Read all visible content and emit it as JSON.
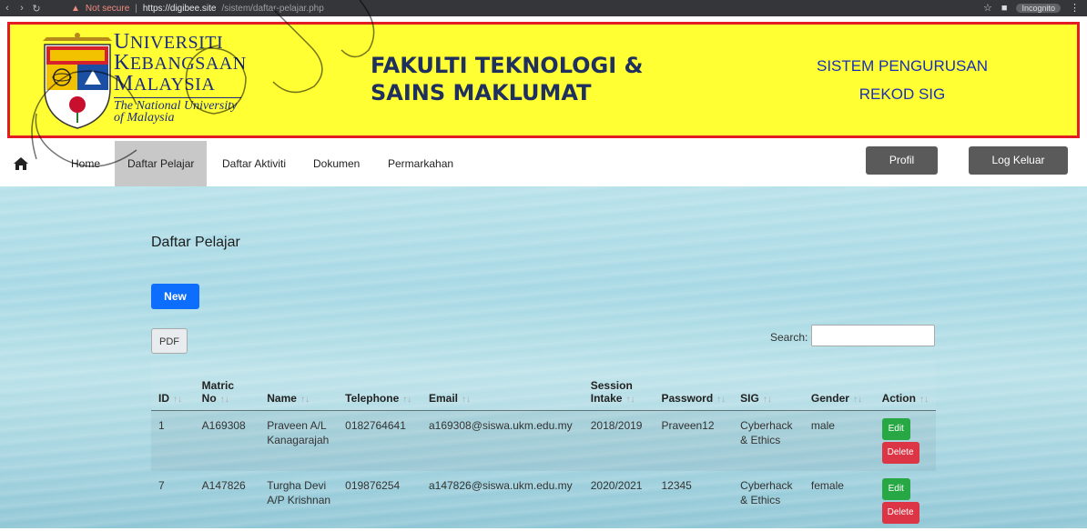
{
  "browser": {
    "security": "Not secure",
    "host": "https://digibee.site",
    "path": "/sistem/daftar-pelajar.php",
    "mode": "Incognito"
  },
  "header": {
    "ukm": {
      "line1_cap": "U",
      "line1_rest": "NIVERSITI",
      "line2_cap": "K",
      "line2_rest": "EBANGSAAN",
      "line3_cap": "M",
      "line3_rest": "ALAYSIA",
      "eng1": "The National University",
      "eng2": "of Malaysia"
    },
    "faculty_line1": "FAKULTI TEKNOLOGI &",
    "faculty_line2": "SAINS MAKLUMAT",
    "system_line1": "SISTEM PENGURUSAN",
    "system_line2": "REKOD SIG",
    "colors": {
      "banner": "#ffff33",
      "border": "#e31b23"
    }
  },
  "nav": {
    "items": [
      {
        "label": "Home"
      },
      {
        "label": "Daftar Pelajar"
      },
      {
        "label": "Daftar Aktiviti"
      },
      {
        "label": "Dokumen"
      },
      {
        "label": "Permarkahan"
      }
    ],
    "active": "Daftar Pelajar",
    "profile_label": "Profil",
    "logout_label": "Log Keluar"
  },
  "page": {
    "title": "Daftar Pelajar",
    "new_label": "New",
    "pdf_label": "PDF",
    "search_label": "Search:",
    "search_value": ""
  },
  "table": {
    "headers": [
      {
        "line1": "ID",
        "line2": ""
      },
      {
        "line1": "Matric",
        "line2": "No"
      },
      {
        "line1": "Name",
        "line2": ""
      },
      {
        "line1": "Telephone",
        "line2": ""
      },
      {
        "line1": "Email",
        "line2": ""
      },
      {
        "line1": "Session",
        "line2": "Intake"
      },
      {
        "line1": "Password",
        "line2": ""
      },
      {
        "line1": "SIG",
        "line2": ""
      },
      {
        "line1": "Gender",
        "line2": ""
      },
      {
        "line1": "Action",
        "line2": ""
      }
    ],
    "rows": [
      {
        "id": "1",
        "matric": "A169308",
        "name": "Praveen A/L Kanagarajah",
        "telephone": "0182764641",
        "email": "a169308@siswa.ukm.edu.my",
        "session": "2018/2019",
        "password": "Praveen12",
        "sig": "Cyberhack & Ethics",
        "gender": "male"
      },
      {
        "id": "7",
        "matric": "A147826",
        "name": "Turgha Devi A/P Krishnan",
        "telephone": "019876254",
        "email": "a147826@siswa.ukm.edu.my",
        "session": "2020/2021",
        "password": "12345",
        "sig": "Cyberhack & Ethics",
        "gender": "female"
      }
    ],
    "edit_label": "Edit",
    "delete_label": "Delete",
    "colors": {
      "new": "#0d6efd",
      "edit": "#28a745",
      "delete": "#dc3545"
    }
  }
}
